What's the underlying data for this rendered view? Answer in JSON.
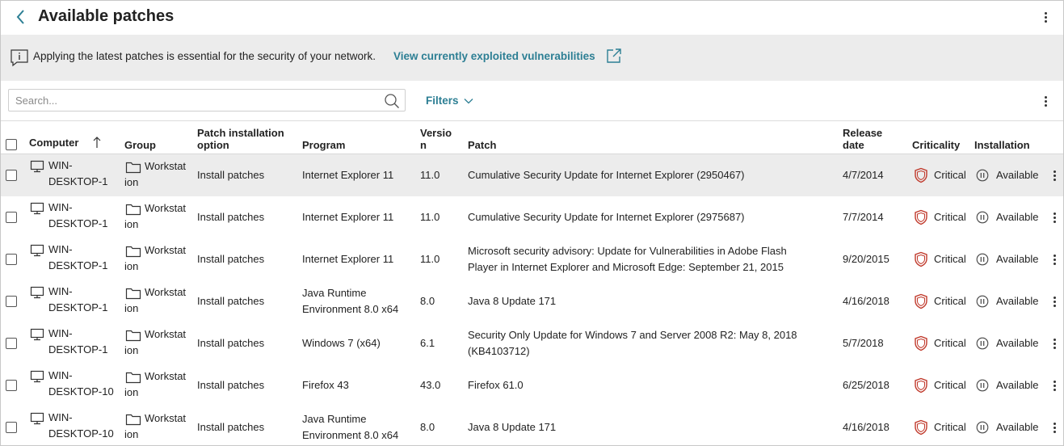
{
  "header": {
    "title": "Available patches"
  },
  "banner": {
    "message": "Applying the latest patches is essential for the security of your network.",
    "link": "View currently exploited vulnerabilities"
  },
  "toolbar": {
    "search_placeholder": "Search...",
    "filters_label": "Filters"
  },
  "columns": {
    "computer": "Computer",
    "group": "Group",
    "option_line1": "Patch installation",
    "option_line2": "option",
    "program": "Program",
    "version_line1": "Versio",
    "version_line2": "n",
    "patch": "Patch",
    "release_line1": "Release",
    "release_line2": "date",
    "criticality": "Criticality",
    "installation": "Installation"
  },
  "rows": [
    {
      "computer": [
        "WIN-",
        "DESKTOP-1"
      ],
      "group": [
        "Workstat",
        "ion"
      ],
      "option": "Install patches",
      "program": [
        "Internet Explorer 11"
      ],
      "version": "11.0",
      "patch": [
        "Cumulative Security Update for Internet Explorer (2950467)"
      ],
      "release": "4/7/2014",
      "criticality": "Critical",
      "installation": "Available"
    },
    {
      "computer": [
        "WIN-",
        "DESKTOP-1"
      ],
      "group": [
        "Workstat",
        "ion"
      ],
      "option": "Install patches",
      "program": [
        "Internet Explorer 11"
      ],
      "version": "11.0",
      "patch": [
        "Cumulative Security Update for Internet Explorer (2975687)"
      ],
      "release": "7/7/2014",
      "criticality": "Critical",
      "installation": "Available"
    },
    {
      "computer": [
        "WIN-",
        "DESKTOP-1"
      ],
      "group": [
        "Workstat",
        "ion"
      ],
      "option": "Install patches",
      "program": [
        "Internet Explorer 11"
      ],
      "version": "11.0",
      "patch": [
        "Microsoft security advisory: Update for Vulnerabilities in Adobe Flash",
        "Player in Internet Explorer and Microsoft Edge: September 21, 2015"
      ],
      "release": "9/20/2015",
      "criticality": "Critical",
      "installation": "Available"
    },
    {
      "computer": [
        "WIN-",
        "DESKTOP-1"
      ],
      "group": [
        "Workstat",
        "ion"
      ],
      "option": "Install patches",
      "program": [
        "Java Runtime",
        "Environment 8.0 x64"
      ],
      "version": "8.0",
      "patch": [
        "Java 8 Update 171"
      ],
      "release": "4/16/2018",
      "criticality": "Critical",
      "installation": "Available"
    },
    {
      "computer": [
        "WIN-",
        "DESKTOP-1"
      ],
      "group": [
        "Workstat",
        "ion"
      ],
      "option": "Install patches",
      "program": [
        "Windows 7 (x64)"
      ],
      "version": "6.1",
      "patch": [
        "Security Only Update for Windows 7 and Server 2008 R2: May 8, 2018",
        "(KB4103712)"
      ],
      "release": "5/7/2018",
      "criticality": "Critical",
      "installation": "Available"
    },
    {
      "computer": [
        "WIN-",
        "DESKTOP-10"
      ],
      "group": [
        "Workstat",
        "ion"
      ],
      "option": "Install patches",
      "program": [
        "Firefox 43"
      ],
      "version": "43.0",
      "patch": [
        "Firefox 61.0"
      ],
      "release": "6/25/2018",
      "criticality": "Critical",
      "installation": "Available"
    },
    {
      "computer": [
        "WIN-",
        "DESKTOP-10"
      ],
      "group": [
        "Workstat",
        "ion"
      ],
      "option": "Install patches",
      "program": [
        "Java Runtime",
        "Environment 8.0 x64"
      ],
      "version": "8.0",
      "patch": [
        "Java 8 Update 171"
      ],
      "release": "4/16/2018",
      "criticality": "Critical",
      "installation": "Available"
    }
  ],
  "icons": {
    "back": "chevron-left-icon",
    "info": "info-icon",
    "external": "external-link-icon",
    "search": "search-icon",
    "filters": "chevron-down-icon",
    "sort": "arrow-up-icon",
    "computer": "monitor-icon",
    "group": "folder-icon",
    "criticality": "shield-icon",
    "installation": "pause-circle-icon",
    "menu": "kebab-icon"
  },
  "colors": {
    "accent": "#2d7f94",
    "critical": "#c0392b",
    "banner_bg": "#ececec",
    "row_highlight": "#ececec"
  }
}
